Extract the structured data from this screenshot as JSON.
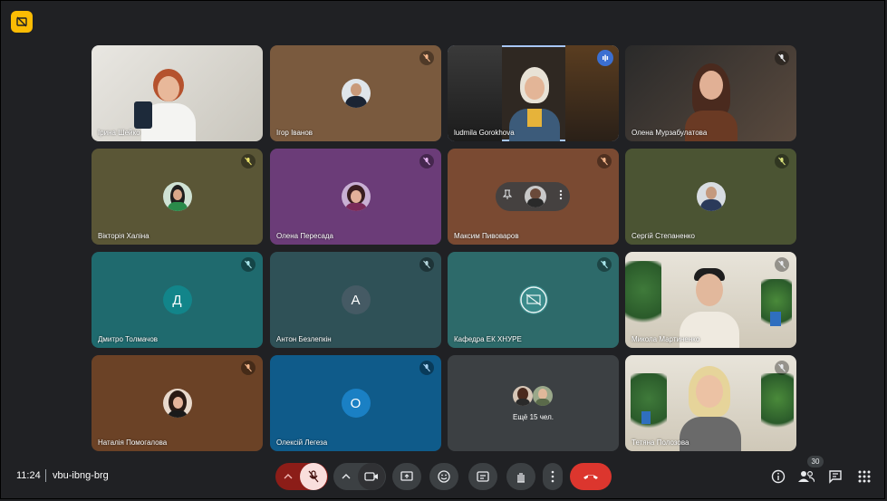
{
  "meeting": {
    "time": "11:24",
    "code": "vbu-ibng-brg",
    "participants_count": "30"
  },
  "tiles": [
    {
      "name": "Ірина Шейко",
      "muted": false,
      "bg": "#d9d6cf"
    },
    {
      "name": "Ігор Іванов",
      "muted": true,
      "bg": "#7a5a3e"
    },
    {
      "name": "ludmila Gorokhova",
      "muted": false,
      "speaking": true,
      "bg": "#3a3228"
    },
    {
      "name": "Олена Мурзабулатова",
      "muted": true,
      "bg": "#3b2e28"
    },
    {
      "name": "Вікторія Халіна",
      "muted": true,
      "bg": "#5a5636"
    },
    {
      "name": "Олена Пересада",
      "muted": true,
      "bg": "#6b3c78"
    },
    {
      "name": "Максим Пивоваров",
      "muted": true,
      "bg": "#7a4a32"
    },
    {
      "name": "Сергій Степаненко",
      "muted": true,
      "bg": "#4b5433"
    },
    {
      "name": "Дмитро Толмачов",
      "muted": true,
      "bg": "#1f6a6e",
      "letter": "Д",
      "letter_bg": "#12858a"
    },
    {
      "name": "Антон Безлепкін",
      "muted": true,
      "bg": "#2f5157",
      "letter": "А",
      "letter_bg": "#455a64"
    },
    {
      "name": "Кафедра ЕК ХНУРЕ",
      "muted": true,
      "bg": "#2d6a6a"
    },
    {
      "name": "Микола Мартиненко",
      "muted": true,
      "bg": "#d8d3c6"
    },
    {
      "name": "Наталія Помогалова",
      "muted": true,
      "bg": "#6b4226"
    },
    {
      "name": "Олексій Легеза",
      "muted": true,
      "bg": "#0f5b8a",
      "letter": "О",
      "letter_bg": "#1a80c4"
    },
    {
      "name": "",
      "more": "Ещё 15 чел.",
      "bg": "#3c4043"
    },
    {
      "name": "Тетяна Полозова",
      "muted": true,
      "bg": "#dcd6c8"
    }
  ]
}
